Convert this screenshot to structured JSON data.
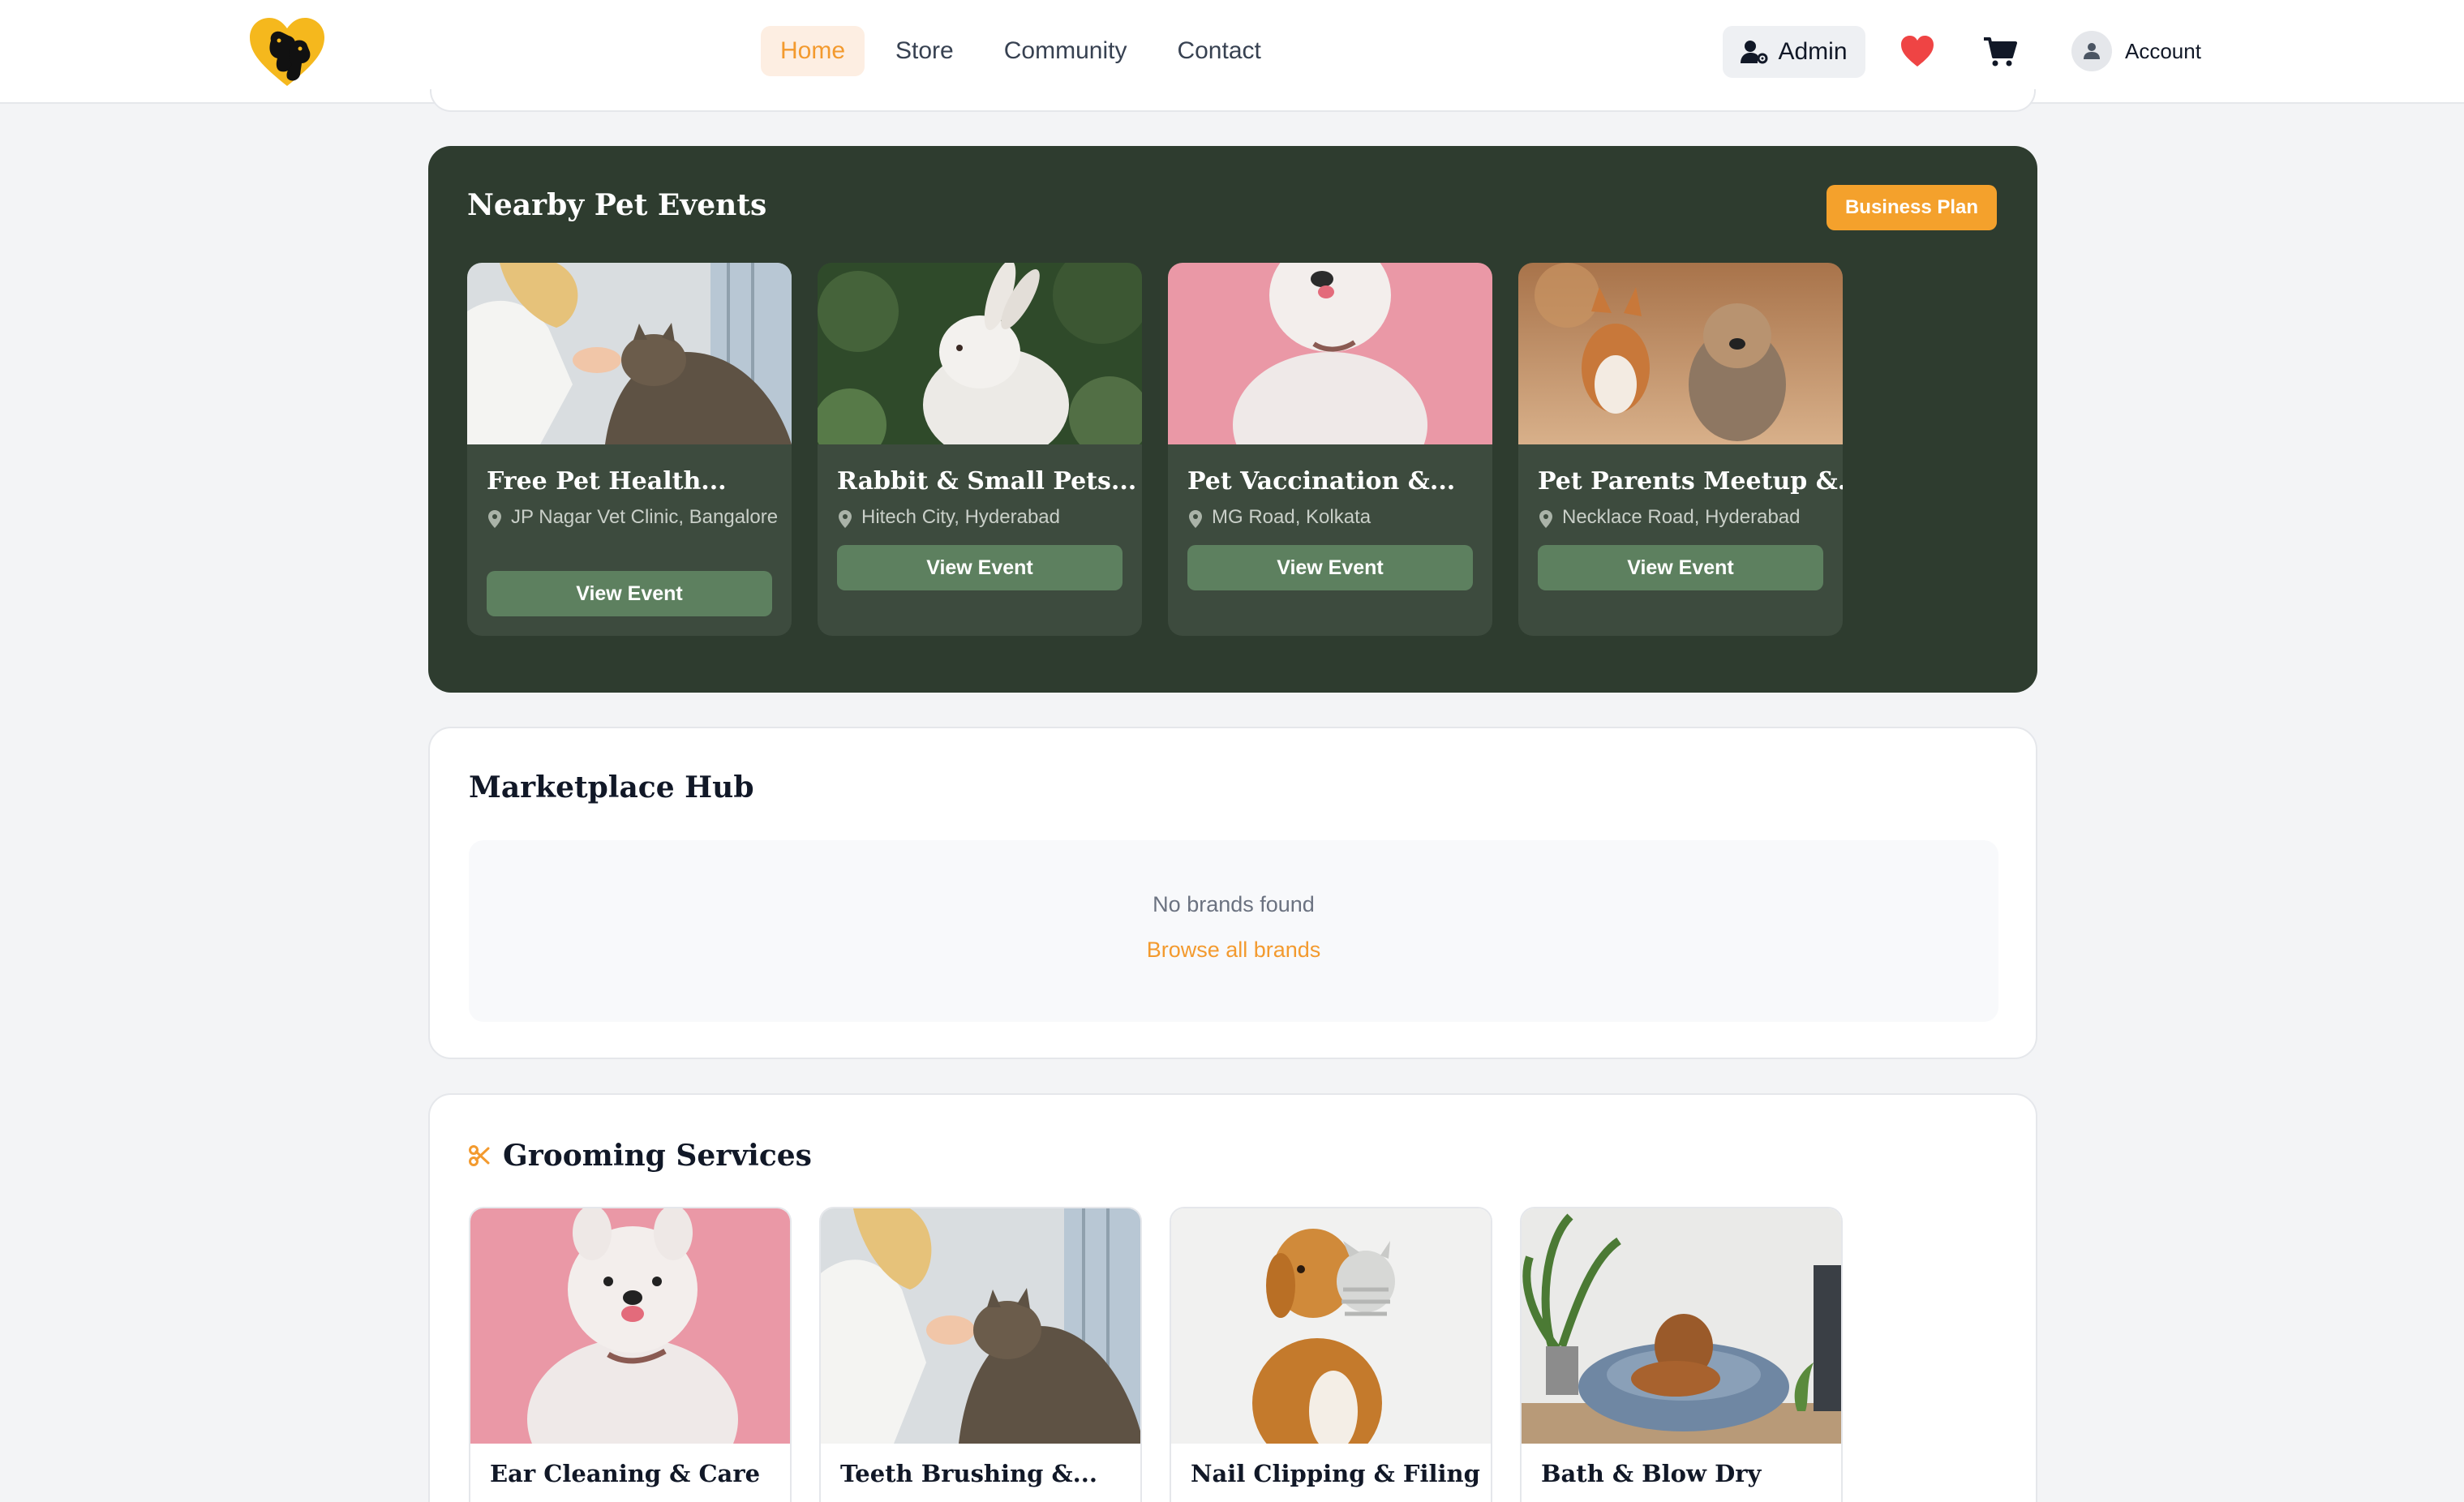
{
  "header": {
    "nav": [
      {
        "label": "Home",
        "active": true
      },
      {
        "label": "Store",
        "active": false
      },
      {
        "label": "Community",
        "active": false
      },
      {
        "label": "Contact",
        "active": false
      }
    ],
    "admin_label": "Admin",
    "account_label": "Account"
  },
  "events": {
    "title": "Nearby Pet Events",
    "business_plan_label": "Business Plan",
    "cards": [
      {
        "title": "Free Pet Health...",
        "location": "JP Nagar Vet Clinic, Bangalore",
        "button": "View Event",
        "image": "woman-with-cat-photo"
      },
      {
        "title": "Rabbit & Small Pets...",
        "location": "Hitech City, Hyderabad",
        "button": "View Event",
        "image": "white-rabbit-photo"
      },
      {
        "title": "Pet Vaccination &...",
        "location": "MG Road, Kolkata",
        "button": "View Event",
        "image": "white-dog-pink-background-photo"
      },
      {
        "title": "Pet Parents Meetup &...",
        "location": "Necklace Road, Hyderabad",
        "button": "View Event",
        "image": "corgi-and-terrier-photo"
      }
    ]
  },
  "marketplace": {
    "title": "Marketplace Hub",
    "empty_text": "No brands found",
    "browse_link": "Browse all brands"
  },
  "grooming": {
    "title": "Grooming Services",
    "icon": "scissors-icon",
    "cards": [
      {
        "title": "Ear Cleaning & Care",
        "image": "white-dog-pink-background-photo"
      },
      {
        "title": "Teeth Brushing &...",
        "image": "woman-with-cat-photo"
      },
      {
        "title": "Nail Clipping & Filing",
        "image": "golden-retriever-with-toy-photo"
      },
      {
        "title": "Bath & Blow Dry",
        "image": "dog-in-bed-photo"
      }
    ]
  },
  "colors": {
    "accent": "#f39a2e",
    "events_bg": "#2e3c2f",
    "event_button": "#5d805f",
    "heart": "#ef4444"
  }
}
